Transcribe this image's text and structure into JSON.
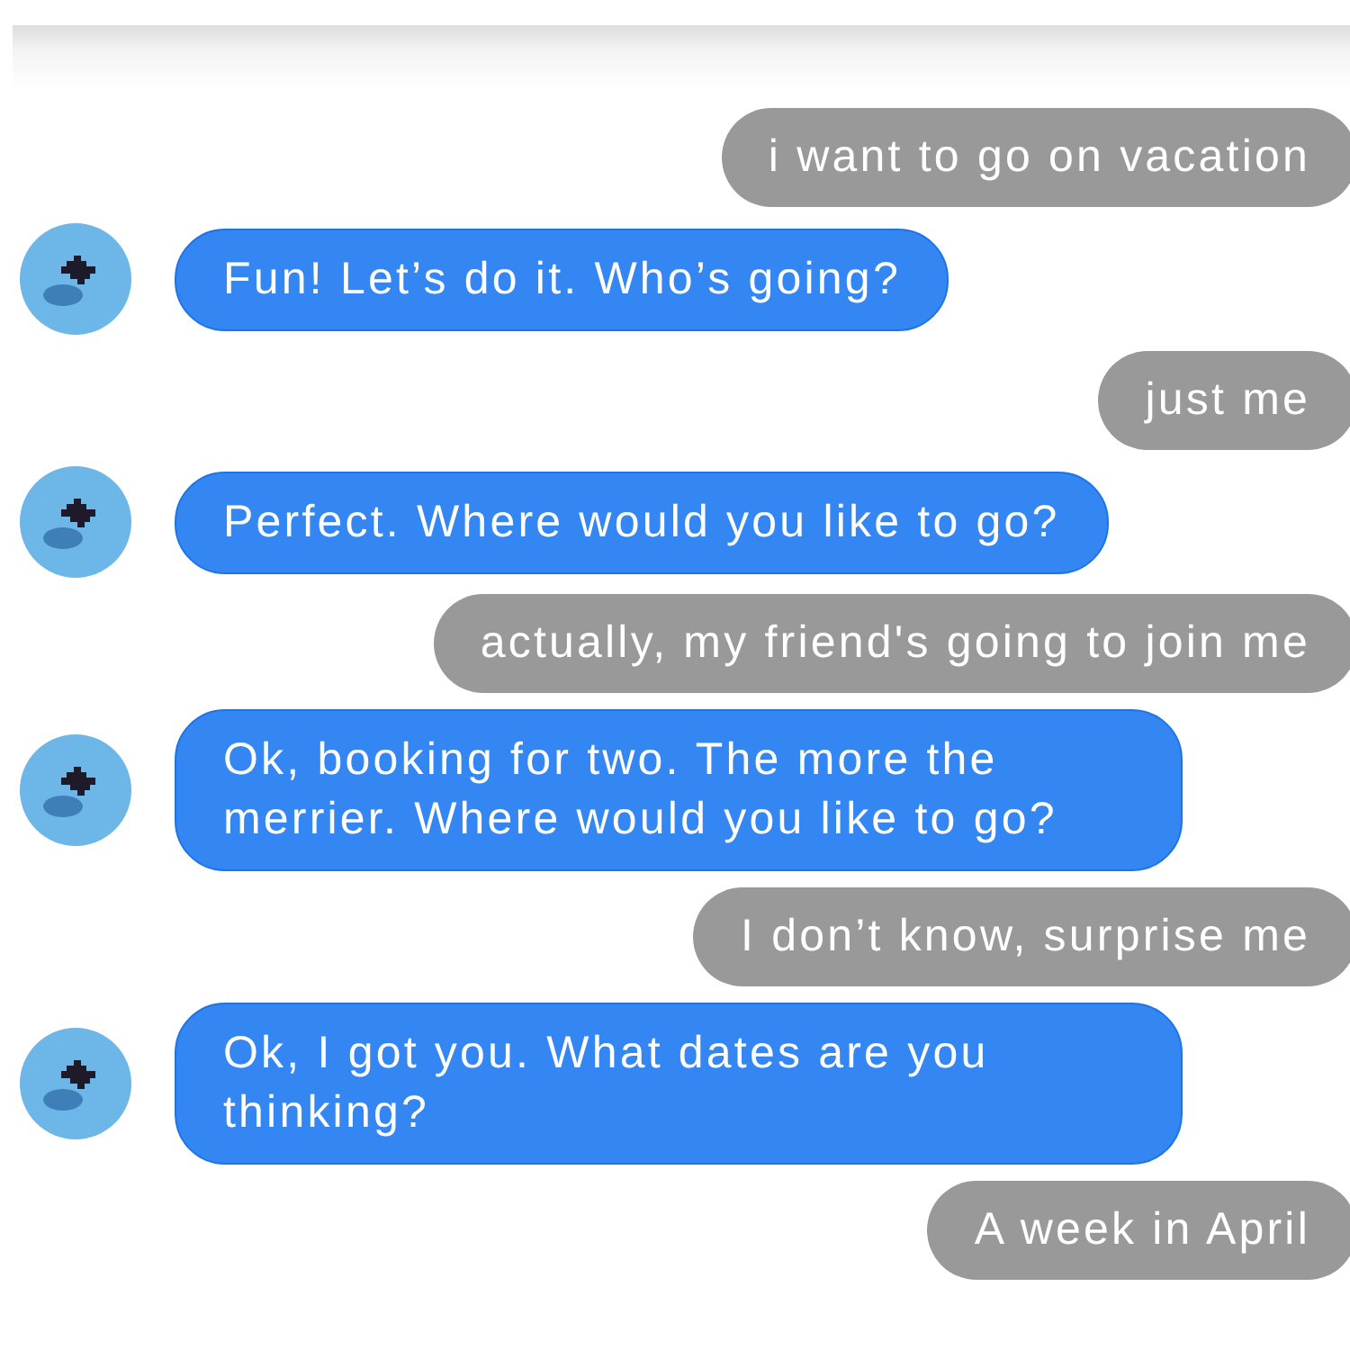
{
  "messages": [
    {
      "kind": "user",
      "text": "i want to go on vacation"
    },
    {
      "kind": "bot",
      "text": "Fun! Let’s do it. Who’s going?"
    },
    {
      "kind": "user",
      "text": "just me"
    },
    {
      "kind": "bot",
      "text": "Perfect. Where would you like to go?"
    },
    {
      "kind": "user",
      "text": "actually, my friend's going to join me"
    },
    {
      "kind": "bot",
      "text": "Ok, booking for two. The more the merrier. Where would you like to go?"
    },
    {
      "kind": "user",
      "text": "I don’t know, surprise me"
    },
    {
      "kind": "bot",
      "text": "Ok, I got you. What dates are you thinking?"
    },
    {
      "kind": "user",
      "text": "A week in April"
    }
  ]
}
